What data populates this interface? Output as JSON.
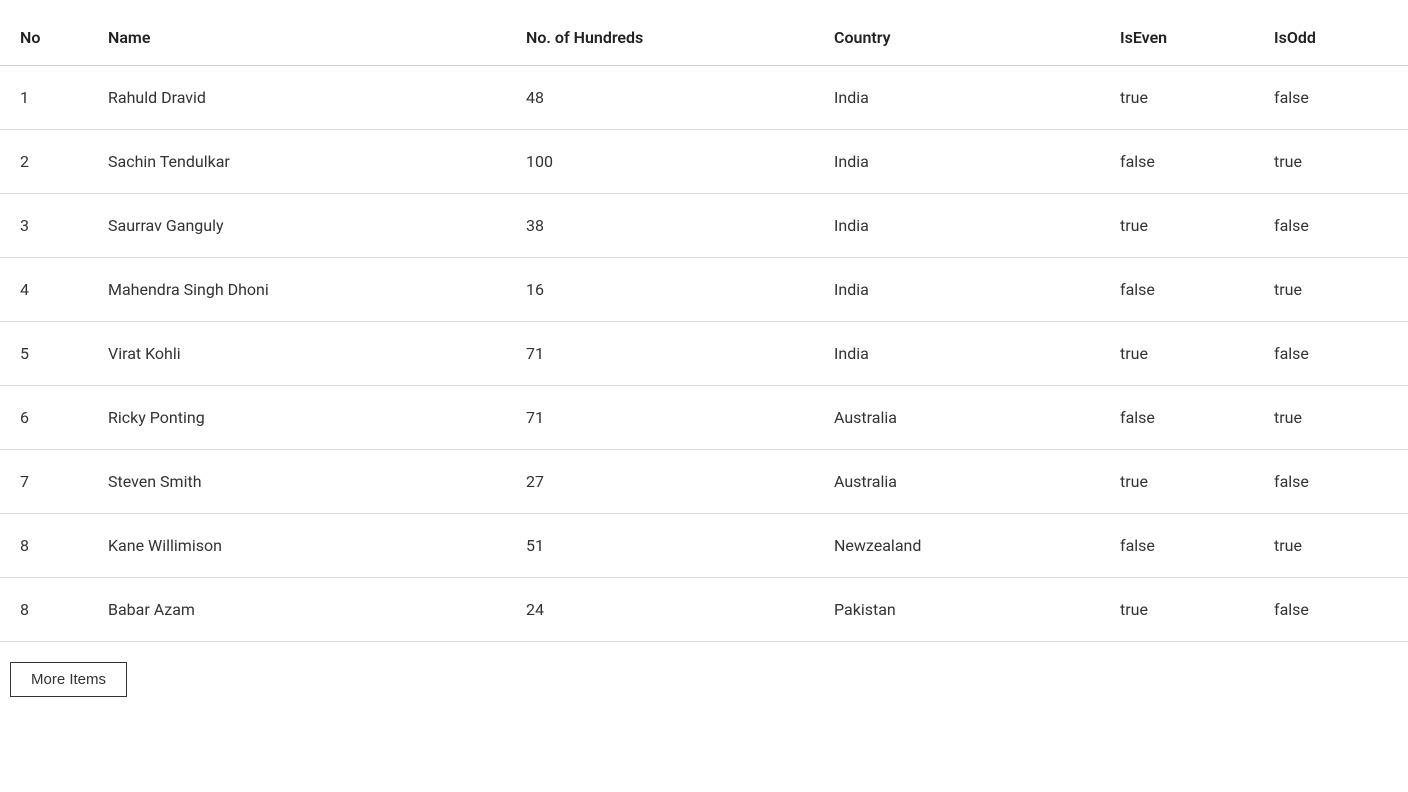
{
  "table": {
    "columns": [
      {
        "key": "no",
        "label": "No"
      },
      {
        "key": "name",
        "label": "Name"
      },
      {
        "key": "hundreds",
        "label": "No. of Hundreds"
      },
      {
        "key": "country",
        "label": "Country"
      },
      {
        "key": "isEven",
        "label": "IsEven"
      },
      {
        "key": "isOdd",
        "label": "IsOdd"
      }
    ],
    "rows": [
      {
        "no": "1",
        "name": "Rahuld Dravid",
        "hundreds": "48",
        "country": "India",
        "isEven": "true",
        "isOdd": "false"
      },
      {
        "no": "2",
        "name": "Sachin Tendulkar",
        "hundreds": "100",
        "country": "India",
        "isEven": "false",
        "isOdd": "true"
      },
      {
        "no": "3",
        "name": "Saurrav Ganguly",
        "hundreds": "38",
        "country": "India",
        "isEven": "true",
        "isOdd": "false"
      },
      {
        "no": "4",
        "name": "Mahendra Singh Dhoni",
        "hundreds": "16",
        "country": "India",
        "isEven": "false",
        "isOdd": "true"
      },
      {
        "no": "5",
        "name": "Virat Kohli",
        "hundreds": "71",
        "country": "India",
        "isEven": "true",
        "isOdd": "false"
      },
      {
        "no": "6",
        "name": "Ricky Ponting",
        "hundreds": "71",
        "country": "Australia",
        "isEven": "false",
        "isOdd": "true"
      },
      {
        "no": "7",
        "name": "Steven Smith",
        "hundreds": "27",
        "country": "Australia",
        "isEven": "true",
        "isOdd": "false"
      },
      {
        "no": "8",
        "name": "Kane Willimison",
        "hundreds": "51",
        "country": "Newzealand",
        "isEven": "false",
        "isOdd": "true"
      },
      {
        "no": "8",
        "name": "Babar Azam",
        "hundreds": "24",
        "country": "Pakistan",
        "isEven": "true",
        "isOdd": "false"
      }
    ]
  },
  "buttons": {
    "more_items": "More Items"
  }
}
